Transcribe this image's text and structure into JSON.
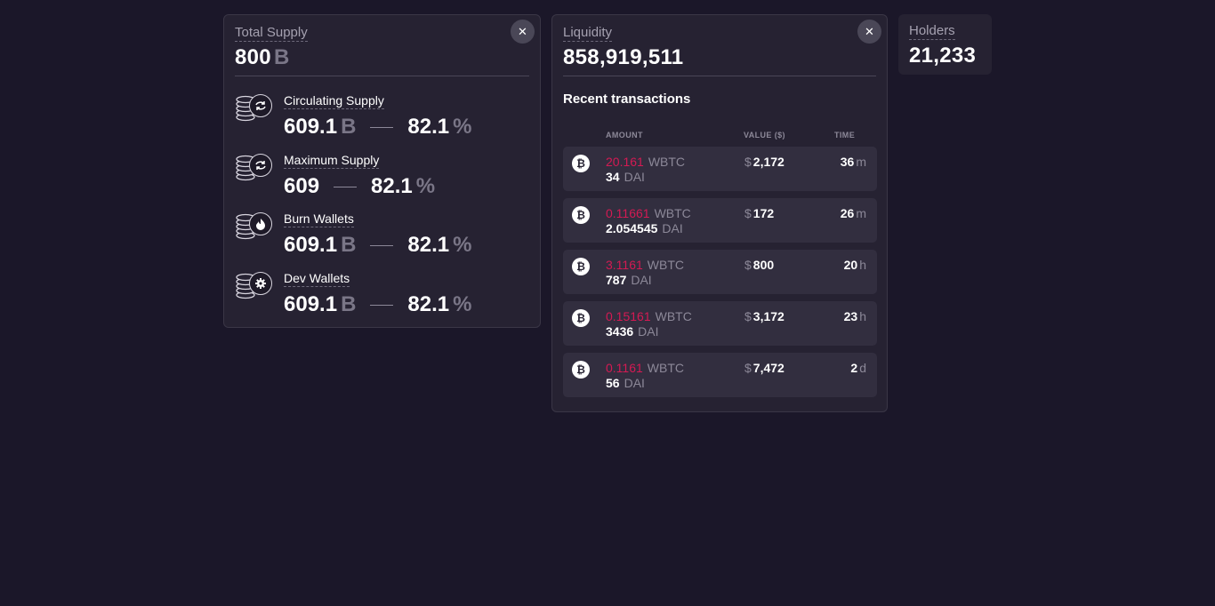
{
  "total_supply": {
    "label": "Total Supply",
    "value": "800",
    "unit": "B",
    "rows": [
      {
        "title": "Circulating Supply",
        "value": "609.1",
        "unit": "B",
        "percent": "82.1",
        "percent_unit": "%",
        "icon": "refresh-icon"
      },
      {
        "title": "Maximum Supply",
        "value": "609",
        "unit": "",
        "percent": "82.1",
        "percent_unit": "%",
        "icon": "refresh-icon"
      },
      {
        "title": "Burn Wallets",
        "value": "609.1",
        "unit": "B",
        "percent": "82.1",
        "percent_unit": "%",
        "icon": "flame-icon"
      },
      {
        "title": "Dev Wallets",
        "value": "609.1",
        "unit": "B",
        "percent": "82.1",
        "percent_unit": "%",
        "icon": "gear-icon"
      }
    ]
  },
  "liquidity": {
    "label": "Liquidity",
    "value": "858,919,511",
    "recent_title": "Recent transactions",
    "headers": {
      "amount": "AMOUNT",
      "value": "VALUE ($)",
      "time": "TIME"
    },
    "transactions": [
      {
        "amount1": "20.161",
        "cur1": "WBTC",
        "amount2": "34",
        "cur2": "DAI",
        "value_sym": "$",
        "value": "2,172",
        "time": "36",
        "time_unit": "m"
      },
      {
        "amount1": "0.11661",
        "cur1": "WBTC",
        "amount2": "2.054545",
        "cur2": "DAI",
        "value_sym": "$",
        "value": "172",
        "time": "26",
        "time_unit": "m"
      },
      {
        "amount1": "3.1161",
        "cur1": "WBTC",
        "amount2": "787",
        "cur2": "DAI",
        "value_sym": "$",
        "value": "800",
        "time": "20",
        "time_unit": "h"
      },
      {
        "amount1": "0.15161",
        "cur1": "WBTC",
        "amount2": "3436",
        "cur2": "DAI",
        "value_sym": "$",
        "value": "3,172",
        "time": "23",
        "time_unit": "h"
      },
      {
        "amount1": "0.1161",
        "cur1": "WBTC",
        "amount2": "56",
        "cur2": "DAI",
        "value_sym": "$",
        "value": "7,472",
        "time": "2",
        "time_unit": "d"
      }
    ]
  },
  "holders": {
    "label": "Holders",
    "value": "21,233"
  },
  "icons": {
    "close": "close-icon",
    "coin": "bitcoin-icon",
    "stack": "coin-stack-icon"
  },
  "colors": {
    "background": "#1b1729",
    "card": "#262232",
    "row": "#322e3f",
    "accent_red": "#d41a53",
    "muted": "#8c8898"
  }
}
